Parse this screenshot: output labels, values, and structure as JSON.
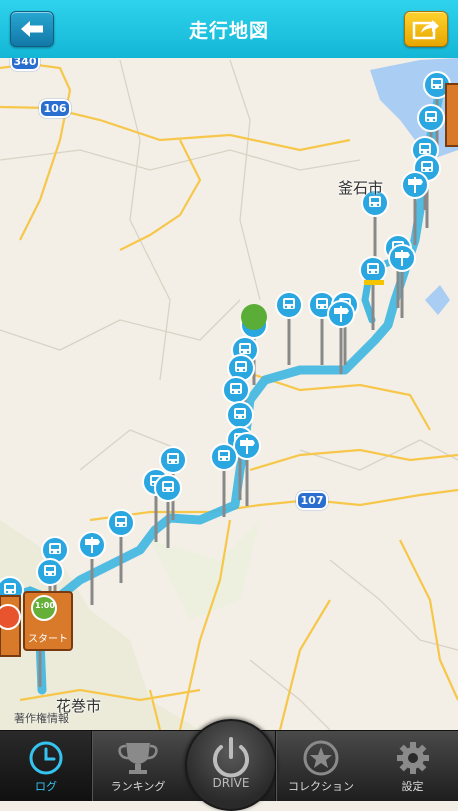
{
  "header": {
    "title": "走行地図"
  },
  "map": {
    "places": {
      "kamaishi": "釜石市",
      "hanamaki": "花巻市"
    },
    "copyright": "著作権情報",
    "route_shields": {
      "r340": "340",
      "r106": "106",
      "r107": "107"
    },
    "marker_labels": {
      "time": "1:00",
      "start": "スタート"
    }
  },
  "tabbar": {
    "log": "ログ",
    "ranking": "ランキング",
    "drive": "DRIVE",
    "collection": "コレクション",
    "settings": "設定"
  },
  "colors": {
    "header": "#1bbfdf",
    "route": "#3ab3d9",
    "accent": "#35c4f0",
    "share_button": "#f5bf12"
  }
}
